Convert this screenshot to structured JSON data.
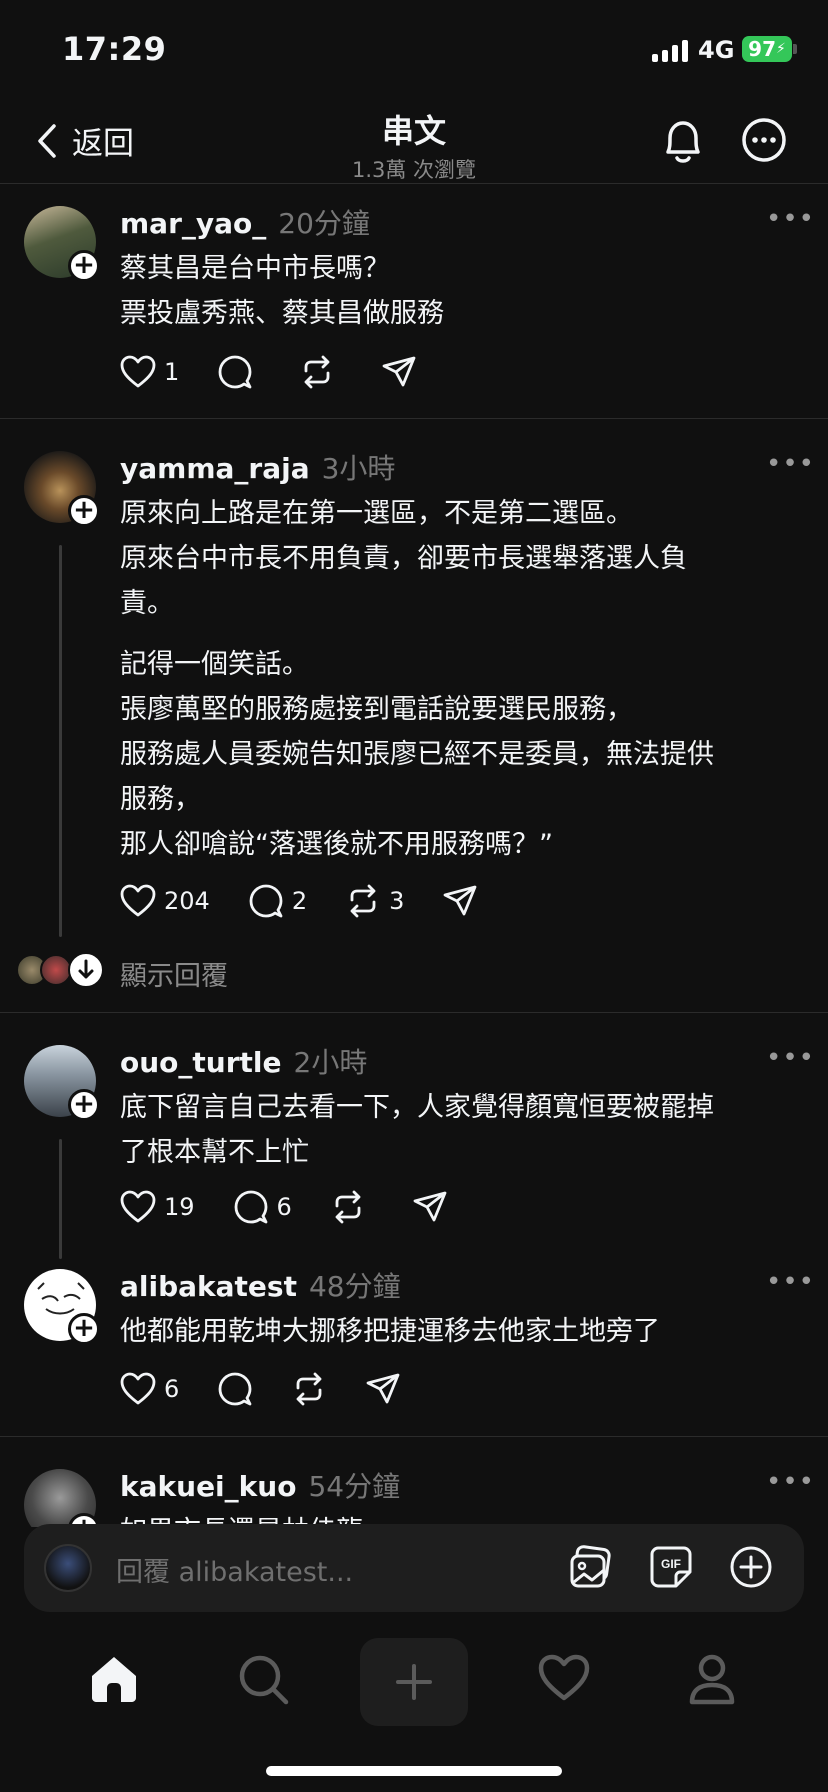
{
  "status": {
    "time": "17:29",
    "network": "4G",
    "battery": "97"
  },
  "header": {
    "back_label": "返回",
    "title": "串文",
    "subtitle": "1.3萬 次瀏覽"
  },
  "posts": [
    {
      "username": "mar_yao_",
      "time": "20分鐘",
      "lines": [
        "蔡其昌是台中市長嗎？",
        "票投盧秀燕、蔡其昌做服務"
      ],
      "likes": "1",
      "replies": "",
      "reposts": ""
    },
    {
      "username": "yamma_raja",
      "time": "3小時",
      "lines": [
        "原來向上路是在第一選區，不是第二選區。",
        "原來台中市長不用負責，卻要市長選舉落選人負",
        "責。",
        "記得一個笑話。",
        "張廖萬堅的服務處接到電話說要選民服務，",
        "服務處人員委婉告知張廖已經不是委員，無法提供",
        "服務，",
        "那人卻嗆說“落選後就不用服務嗎？”"
      ],
      "likes": "204",
      "replies": "2",
      "reposts": "3",
      "show_replies_label": "顯示回覆"
    },
    {
      "username": "ouo_turtle",
      "time": "2小時",
      "lines": [
        "底下留言自己去看一下，人家覺得顏寬恒要被罷掉",
        "了根本幫不上忙"
      ],
      "likes": "19",
      "replies": "6",
      "reposts": ""
    },
    {
      "username": "alibakatest",
      "time": "48分鐘",
      "lines": [
        "他都能用乾坤大挪移把捷運移去他家土地旁了"
      ],
      "likes": "6",
      "replies": "",
      "reposts": ""
    },
    {
      "username": "kakuei_kuo",
      "time": "54分鐘",
      "lines": [
        "如果市長還是林佳龍"
      ],
      "likes": "",
      "replies": "",
      "reposts": ""
    }
  ],
  "reply_bar": {
    "placeholder": "回覆 alibakatest..."
  },
  "icons": {
    "header": [
      "chevron-left-icon",
      "bell-icon",
      "more-circle-icon"
    ],
    "actions": [
      "heart-icon",
      "comment-icon",
      "repost-icon",
      "share-icon"
    ],
    "reply_bar": [
      "image-icon",
      "gif-icon",
      "add-circle-icon"
    ],
    "tabbar": [
      "home-icon",
      "search-icon",
      "new-post-icon",
      "activity-heart-icon",
      "profile-icon"
    ]
  },
  "colors": {
    "background": "#101010",
    "text": "#f3f5f7",
    "muted": "#777777",
    "battery": "#34c759"
  }
}
